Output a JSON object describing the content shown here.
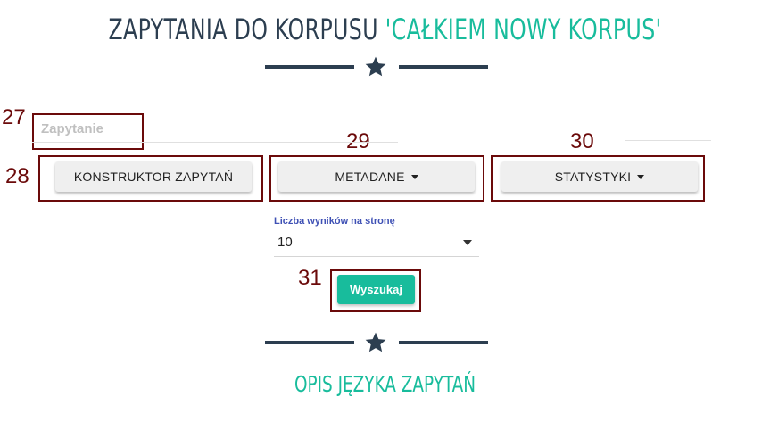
{
  "header": {
    "title_prefix": "ZAPYTANIA DO KORPUSU ",
    "corpus_name": "'CAŁKIEM NOWY KORPUS'"
  },
  "annotations": {
    "query": "27",
    "builder": "28",
    "metadata": "29",
    "stats": "30",
    "search": "31"
  },
  "query": {
    "placeholder": "Zapytanie",
    "value": ""
  },
  "buttons": {
    "builder": "KONSTRUKTOR ZAPYTAŃ",
    "metadata": "METADANE",
    "statistics": "STATYSTYKI"
  },
  "results_per_page": {
    "label": "Liczba wyników na stronę",
    "value": "10"
  },
  "search_button": "Wyszukaj",
  "section_title": "OPIS JĘZYKA ZAPYTAŃ",
  "colors": {
    "primary": "#2c3e50",
    "accent": "#18bc9c",
    "annotation": "#6b0a0a",
    "label": "#3f51b5"
  },
  "icons": [
    "star-icon",
    "caret-down-icon"
  ]
}
